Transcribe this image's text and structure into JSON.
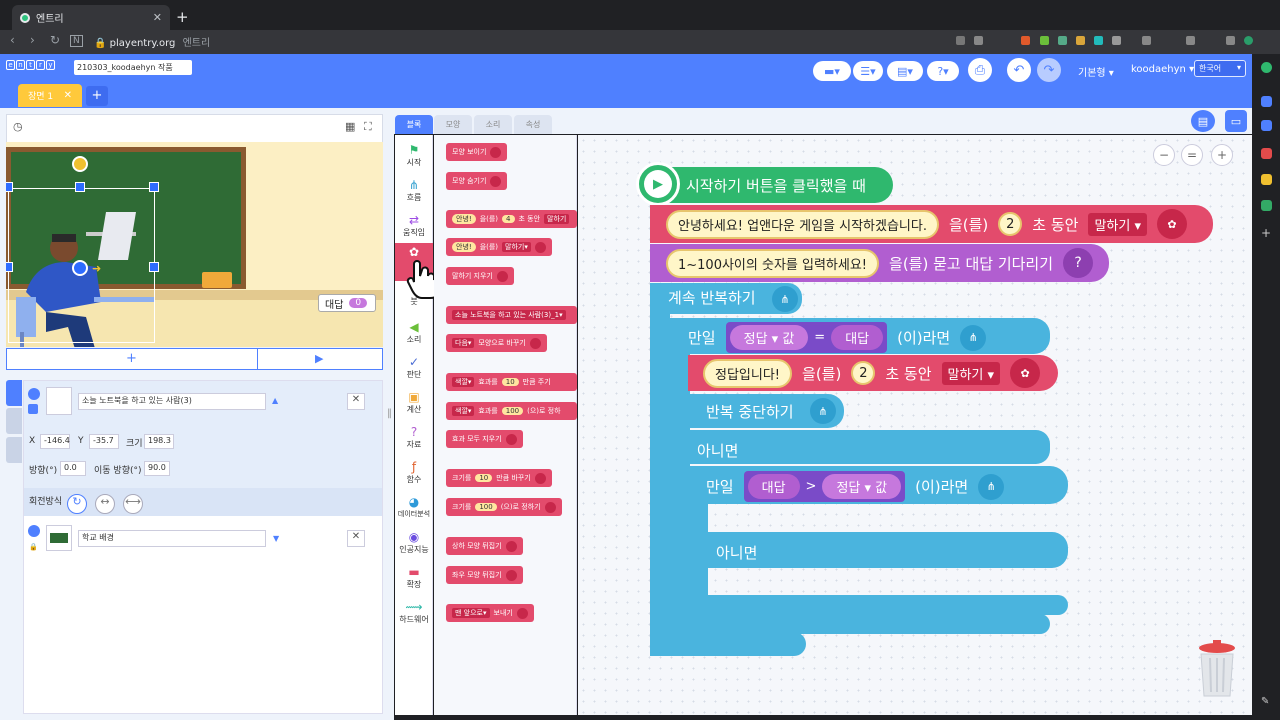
{
  "browser": {
    "tab_title": "엔트리",
    "url": "playentry.org",
    "url_title": "엔트리"
  },
  "header": {
    "logo": [
      "e",
      "n",
      "t",
      "r",
      "y"
    ],
    "project_name": "210303_koodaehyn 작품",
    "scene_tab": "장면 1",
    "mode": "기본형",
    "user": "koodaehyn",
    "language": "한국어"
  },
  "stage": {
    "answer_label": "대답",
    "answer_value": "0"
  },
  "objects": {
    "object1_name": "소늘 노트북을 하고 있는 사람(3)",
    "x_label": "X",
    "x_value": "-146.4",
    "y_label": "Y",
    "y_value": "-35.7",
    "size_label": "크기",
    "size_value": "198.3",
    "direction_label": "방향(°)",
    "direction_value": "0.0",
    "move_direction_label": "이동 방향(°)",
    "move_direction_value": "90.0",
    "rotation_label": "회전방식",
    "object2_name": "학교 배경"
  },
  "tabs": [
    "블록",
    "모양",
    "소리",
    "속성"
  ],
  "categories": [
    {
      "label": "시작",
      "icon": "flag-icon",
      "color": "#2fb86e"
    },
    {
      "label": "흐름",
      "icon": "flow-icon",
      "color": "#2f9fcf"
    },
    {
      "label": "움직임",
      "icon": "move-icon",
      "color": "#9c4be4"
    },
    {
      "label": "",
      "icon": "looks-icon",
      "color": "#e34b6c"
    },
    {
      "label": "붓",
      "icon": "brush-icon",
      "color": "#777"
    },
    {
      "label": "소리",
      "icon": "sound-icon",
      "color": "#6bbf3a"
    },
    {
      "label": "판단",
      "icon": "judge-icon",
      "color": "#4a6cd4"
    },
    {
      "label": "계산",
      "icon": "calc-icon",
      "color": "#f0a93a"
    },
    {
      "label": "자료",
      "icon": "data-icon",
      "color": "#b15ed0"
    },
    {
      "label": "함수",
      "icon": "function-icon",
      "color": "#e0602c"
    },
    {
      "label": "데이터분석",
      "icon": "analysis-icon",
      "color": "#2e9ad9"
    },
    {
      "label": "인공지능",
      "icon": "ai-icon",
      "color": "#6a4de0"
    },
    {
      "label": "확장",
      "icon": "extension-icon",
      "color": "#e34b6c"
    },
    {
      "label": "하드웨어",
      "icon": "hardware-icon",
      "color": "#2fb8a8"
    }
  ],
  "palette": {
    "show": "모양 보이기",
    "hide": "모양 숨기기",
    "say_for_hello": "안녕!",
    "say_for_mid": "을(를)",
    "say_for_num": "4",
    "say_for_tail": "초 동안",
    "say_for_dd": "말하기",
    "say_hello": "안녕!",
    "say_mid": "을(를)",
    "say_dd": "말하기",
    "erase_say": "말하기 지우기",
    "shape_dd": "소늘 노트북을 하고 있는 사람(3)_1",
    "next_dd": "다음",
    "next_tail": "모양으로 바꾸기",
    "color_dd": "색깔",
    "effect_label": "효과를",
    "effect_num": "10",
    "effect_tail": "만큼 주기",
    "color2_dd": "색깔",
    "effect2_label": "효과를",
    "effect2_num": "100",
    "effect2_tail": "(으)로 정하",
    "clear_effects": "효과 모두 지우기",
    "size_label": "크기를",
    "size_num": "10",
    "size_tail": "만큼 바꾸기",
    "size2_label": "크기를",
    "size2_num": "100",
    "size2_tail": "(으)로 정하기",
    "flip_v": "상하 모양 뒤집기",
    "flip_h": "좌우 모양 뒤집기",
    "front_dd": "맨 앞으로",
    "front_tail": "보내기"
  },
  "script": {
    "start": "시작하기 버튼을 클릭했을 때",
    "say1_text": "안녕하세요! 업앤다운 게임을 시작하겠습니다.",
    "say1_mid": "을(를)",
    "say1_num": "2",
    "say1_tail": "초 동안",
    "say1_dd": "말하기",
    "ask_text": "1~100사이의 숫자를 입력하세요!",
    "ask_tail": "을(를) 묻고 대답 기다리기",
    "ask_icon": "?",
    "repeat": "계속 반복하기",
    "if1": "만일",
    "if1_var": "정답",
    "if1_val": "값",
    "if1_op": "=",
    "if1_answer": "대답",
    "if1_tail": "(이)라면",
    "say2_text": "정답입니다!",
    "say2_mid": "을(를)",
    "say2_num": "2",
    "say2_tail": "초 동안",
    "say2_dd": "말하기",
    "stop": "반복 중단하기",
    "else1": "아니면",
    "if2": "만일",
    "if2_answer": "대답",
    "if2_op": ">",
    "if2_var": "정답",
    "if2_val": "값",
    "if2_tail": "(이)라면",
    "else2": "아니면"
  },
  "colors": {
    "entry_blue": "#4f80ff",
    "start_green": "#2fb86e",
    "looks_red": "#e34b6c",
    "flow_cyan": "#4ab4de",
    "judge_purple": "#7a4bc8"
  }
}
